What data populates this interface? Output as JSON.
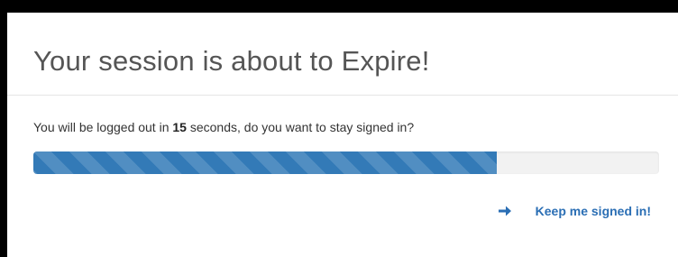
{
  "dialog": {
    "title": "Your session is about to Expire!",
    "message_prefix": "You will be logged out in ",
    "seconds": "15",
    "message_suffix": " seconds, do you want to stay signed in?",
    "progress_fraction": 0.74,
    "keep_signed_in_label": "Keep me signed in!",
    "button_icon": "arrow-right-icon"
  },
  "colors": {
    "progress_bar": "#337ab7",
    "link": "#2a6eb4"
  }
}
